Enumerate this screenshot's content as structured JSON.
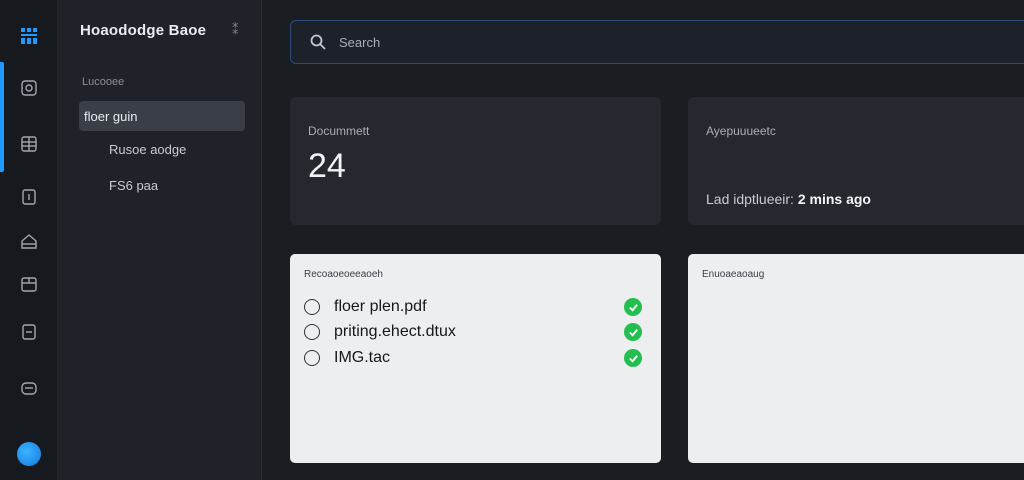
{
  "sidebar": {
    "brand": "Hoaododge Baoe",
    "section_label": "Lucooee",
    "items": [
      {
        "label": "floer guin"
      },
      {
        "label": "Rusoe aodge"
      },
      {
        "label": "FS6 paa"
      }
    ]
  },
  "search": {
    "placeholder": "Search"
  },
  "stats": {
    "documents_label": "Docummett",
    "documents_value": "24",
    "sync_label": "Ayepuuueetc",
    "last_updated_prefix": "Lad idptlueeir:",
    "last_updated_value": "2 mins ago"
  },
  "files": {
    "label": "Recoaoeoeeaoeh",
    "rows": [
      {
        "name": "floer plen.pdf"
      },
      {
        "name": "priting.ehect.dtux"
      },
      {
        "name": "IMG.tac"
      }
    ]
  },
  "activity": {
    "label": "Enuoaeaoaug"
  },
  "colors": {
    "accent": "#1f9bff",
    "success": "#22bf4f"
  }
}
